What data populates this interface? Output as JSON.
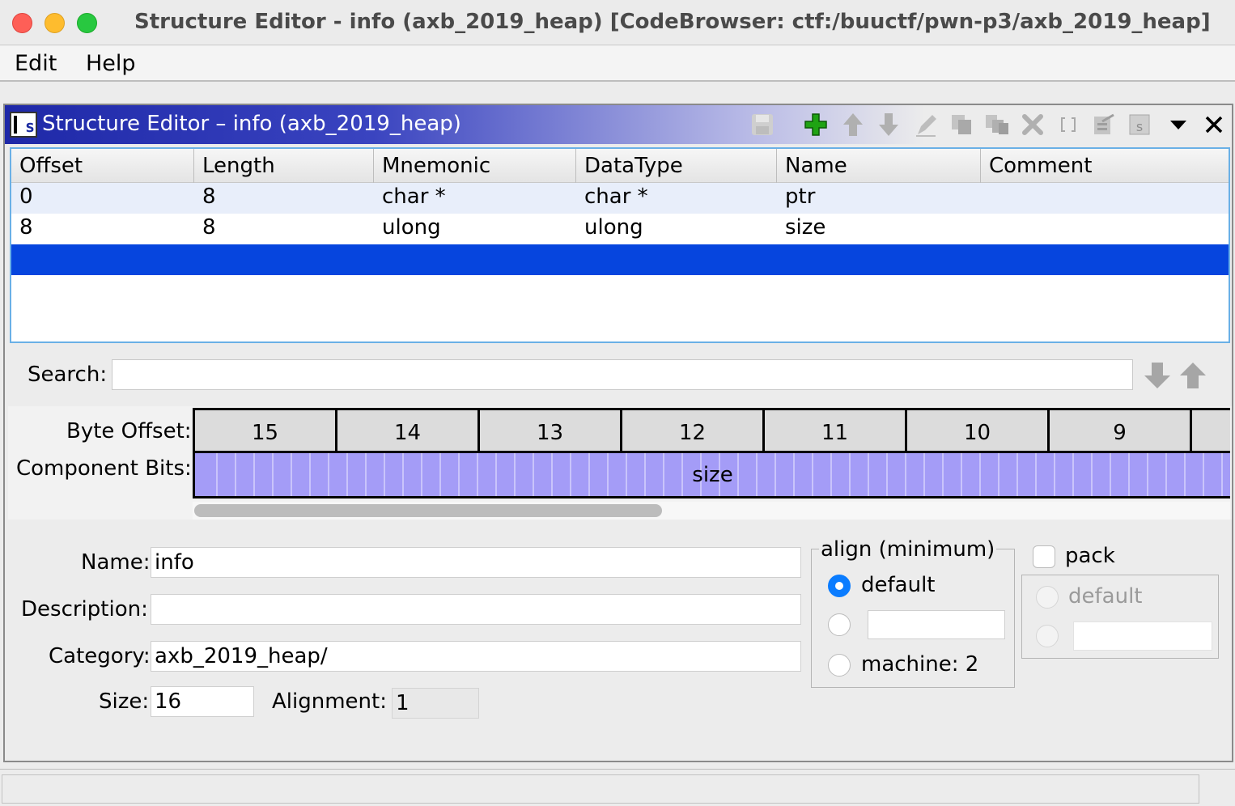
{
  "window": {
    "title": "Structure Editor - info (axb_2019_heap) [CodeBrowser: ctf:/buuctf/pwn-p3/axb_2019_heap]"
  },
  "menu": {
    "edit": "Edit",
    "help": "Help"
  },
  "panel": {
    "title": "Structure Editor – info (axb_2019_heap)",
    "icon_letter": "s",
    "toolbar_icons": [
      "save-icon",
      "add-icon",
      "move-up-icon",
      "move-down-icon",
      "edit-icon",
      "duplicate-icon",
      "duplicate-multiple-icon",
      "delete-icon",
      "array-icon",
      "create-structure-icon",
      "unpack-icon",
      "menu-dropdown-icon",
      "close-icon"
    ]
  },
  "table": {
    "columns": [
      "Offset",
      "Length",
      "Mnemonic",
      "DataType",
      "Name",
      "Comment"
    ],
    "rows": [
      {
        "offset": "0",
        "length": "8",
        "mnemonic": "char *",
        "datatype": "char *",
        "name": "ptr",
        "comment": ""
      },
      {
        "offset": "8",
        "length": "8",
        "mnemonic": "ulong",
        "datatype": "ulong",
        "name": "size",
        "comment": ""
      },
      {
        "offset": "",
        "length": "",
        "mnemonic": "",
        "datatype": "",
        "name": "",
        "comment": ""
      }
    ],
    "selected_row": 2
  },
  "search": {
    "label": "Search:",
    "value": ""
  },
  "bit_viewer": {
    "byte_offset_label": "Byte Offset:",
    "component_bits_label": "Component Bits:",
    "bytes": [
      "15",
      "14",
      "13",
      "12",
      "11",
      "10",
      "9"
    ],
    "component": "size",
    "component_color": "#a49cf7"
  },
  "form": {
    "name_label": "Name:",
    "name_value": "info",
    "description_label": "Description:",
    "description_value": "",
    "category_label": "Category:",
    "category_value": "axb_2019_heap/",
    "size_label": "Size:",
    "size_value": "16",
    "alignment_label": "Alignment:",
    "alignment_value": "1"
  },
  "align_group": {
    "title": "align (minimum)",
    "default_label": "default",
    "custom_value": "",
    "machine_label": "machine: 2",
    "selected": "default"
  },
  "pack_group": {
    "pack_label": "pack",
    "pack_checked": false,
    "default_label": "default",
    "custom_value": ""
  },
  "colors": {
    "selection": "#0645de",
    "title_gradient_start": "#1e28a8",
    "radio_on": "#0a7cff"
  }
}
